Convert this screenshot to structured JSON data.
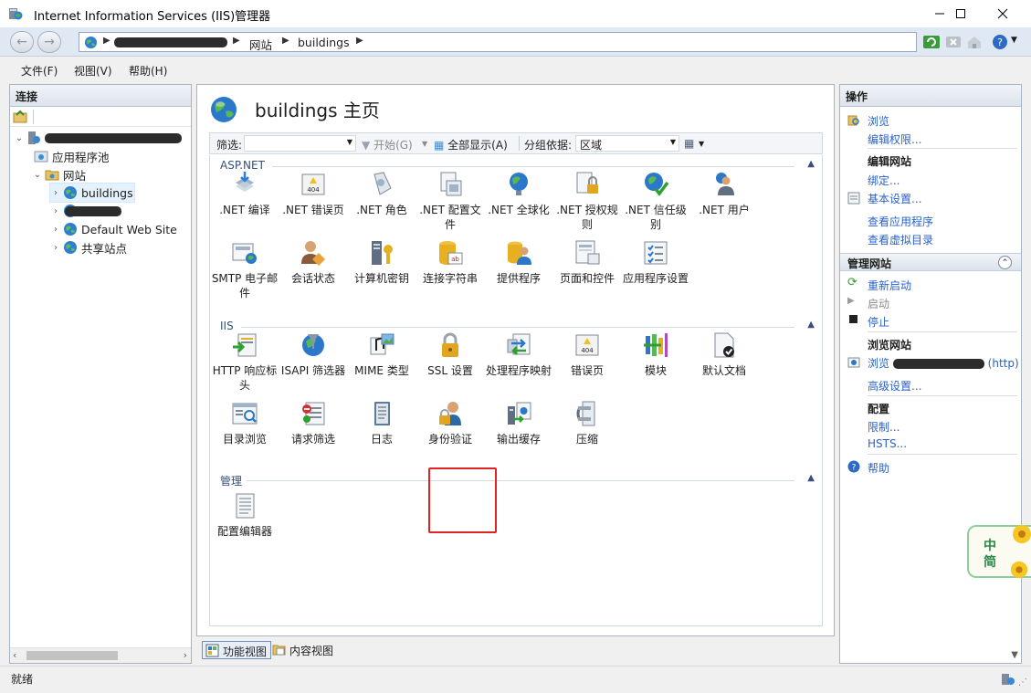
{
  "window": {
    "title": "Internet Information Services (IIS)管理器"
  },
  "address": {
    "seg_site": "网站",
    "seg_page": "buildings"
  },
  "menu": [
    "文件(F)",
    "视图(V)",
    "帮助(H)"
  ],
  "connections": {
    "header": "连接",
    "tree": {
      "app_pools": "应用程序池",
      "sites": "网站",
      "buildings": "buildings",
      "default_site": "Default Web Site",
      "shared_site": "共享站点"
    }
  },
  "main": {
    "title": "buildings 主页",
    "filter_label": "筛选:",
    "start_label": "开始(G)",
    "show_all_label": "全部显示(A)",
    "group_by_label": "分组依据:",
    "group_by_value": "区域",
    "groups": {
      "aspnet": "ASP.NET",
      "iis": "IIS",
      "manage": "管理"
    },
    "features": {
      "net_compile": ".NET 编译",
      "net_error": ".NET 错误页",
      "net_roles": ".NET 角色",
      "net_config": ".NET 配置文件",
      "net_global": ".NET 全球化",
      "net_authz": ".NET 授权规则",
      "net_trust": ".NET 信任级别",
      "net_users": ".NET 用户",
      "smtp": "SMTP 电子邮件",
      "session": "会话状态",
      "machine_key": "计算机密钥",
      "conn_strings": "连接字符串",
      "providers": "提供程序",
      "pages_controls": "页面和控件",
      "app_settings": "应用程序设置",
      "http_headers": "HTTP 响应标头",
      "isapi": "ISAPI 筛选器",
      "mime": "MIME 类型",
      "ssl": "SSL 设置",
      "handlers": "处理程序映射",
      "error_pages": "错误页",
      "modules": "模块",
      "default_doc": "默认文档",
      "dir_browse": "目录浏览",
      "req_filter": "请求筛选",
      "logging": "日志",
      "auth": "身份验证",
      "output_cache": "输出缓存",
      "compression": "压缩",
      "config_editor": "配置编辑器"
    }
  },
  "views": {
    "features": "功能视图",
    "content": "内容视图"
  },
  "actions": {
    "header": "操作",
    "browse": "浏览",
    "edit_perms": "编辑权限...",
    "edit_site": "编辑网站",
    "bindings": "绑定...",
    "basic_settings": "基本设置...",
    "view_apps": "查看应用程序",
    "view_vdirs": "查看虚拟目录",
    "manage_site": "管理网站",
    "restart": "重新启动",
    "start": "启动",
    "stop": "停止",
    "browse_site": "浏览网站",
    "browse_prefix": "浏览",
    "browse_suffix": "(http)",
    "advanced": "高级设置...",
    "config": "配置",
    "limits": "限制...",
    "hsts": "HSTS...",
    "help": "帮助"
  },
  "ime": {
    "line1": "中",
    "line2": "简"
  },
  "status": {
    "text": "就绪"
  },
  "colors": {
    "link": "#2a62c9",
    "highlight": "#e02424"
  }
}
